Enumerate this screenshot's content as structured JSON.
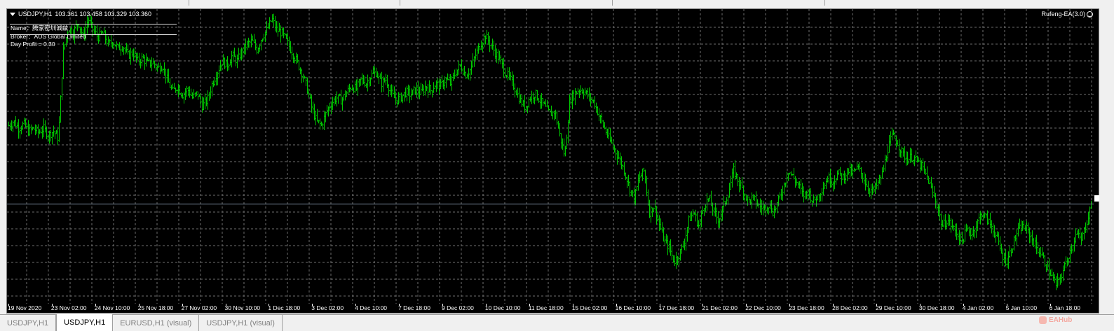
{
  "chart_header": {
    "symbol_label": "USDJPY,H1",
    "ohlc_label": "103.361 103.458 103.329 103.360"
  },
  "expert": {
    "name_label": "Rufeng-EA(3.0)",
    "status_icon": "smiley-icon"
  },
  "info_panel": {
    "name": "Name：腾家密圳诚兹",
    "broker": "Broker：AUS Global Limited",
    "profit": "Day Profit = 0.30"
  },
  "time_axis": [
    "19 Nov 2020",
    "23 Nov 02:00",
    "24 Nov 10:00",
    "25 Nov 18:00",
    "27 Nov 02:00",
    "30 Nov 10:00",
    "1 Dec 18:00",
    "3 Dec 02:00",
    "4 Dec 10:00",
    "7 Dec 18:00",
    "9 Dec 02:00",
    "10 Dec 10:00",
    "11 Dec 18:00",
    "15 Dec 02:00",
    "16 Dec 10:00",
    "17 Dec 18:00",
    "21 Dec 02:00",
    "22 Dec 10:00",
    "23 Dec 18:00",
    "28 Dec 02:00",
    "29 Dec 10:00",
    "30 Dec 18:00",
    "4 Jan 02:00",
    "5 Jan 10:00",
    "6 Jan 18:00"
  ],
  "tabs": [
    {
      "label": "USDJPY,H1",
      "active": false
    },
    {
      "label": "USDJPY,H1",
      "active": true
    },
    {
      "label": "EURUSD,H1 (visual)",
      "active": false
    },
    {
      "label": "USDJPY,H1 (visual)",
      "active": false
    }
  ],
  "watermark": "EAHub",
  "colors": {
    "background": "#000000",
    "grid": "#6e6e6e",
    "bars": "#00c800",
    "bid_line": "#778899"
  },
  "chart_data": {
    "type": "ohlc",
    "symbol": "USDJPY",
    "timeframe": "H1",
    "last": 103.36,
    "ylim": [
      102.65,
      104.75
    ],
    "grid": true,
    "close_path": [
      103.92,
      103.95,
      103.9,
      103.93,
      103.88,
      103.9,
      103.87,
      103.9,
      103.85,
      103.88,
      103.83,
      104.45,
      104.62,
      104.58,
      104.66,
      104.55,
      104.68,
      104.6,
      104.55,
      104.58,
      104.5,
      104.52,
      104.47,
      104.49,
      104.42,
      104.44,
      104.38,
      104.4,
      104.36,
      104.37,
      104.33,
      104.35,
      104.24,
      104.16,
      104.2,
      104.14,
      104.18,
      104.12,
      104.15,
      104.06,
      104.1,
      104.22,
      104.3,
      104.38,
      104.35,
      104.42,
      104.38,
      104.45,
      104.5,
      104.52,
      104.46,
      104.55,
      104.6,
      104.68,
      104.6,
      104.58,
      104.52,
      104.45,
      104.38,
      104.3,
      104.2,
      104.05,
      103.95,
      103.92,
      104.02,
      104.08,
      104.12,
      104.1,
      104.15,
      104.2,
      104.18,
      104.25,
      104.22,
      104.28,
      104.3,
      104.22,
      104.25,
      104.15,
      104.1,
      104.12,
      104.16,
      104.14,
      104.18,
      104.15,
      104.2,
      104.17,
      104.22,
      104.2,
      104.25,
      104.22,
      104.3,
      104.35,
      104.28,
      104.32,
      104.42,
      104.5,
      104.56,
      104.5,
      104.44,
      104.38,
      104.3,
      104.25,
      104.18,
      104.1,
      104.05,
      104.12,
      104.15,
      104.1,
      104.05,
      104.0,
      104.02,
      103.85,
      103.7,
      104.1,
      104.15,
      104.18,
      104.16,
      104.12,
      104.08,
      103.98,
      103.9,
      103.82,
      103.75,
      103.68,
      103.6,
      103.48,
      103.4,
      103.55,
      103.6,
      103.3,
      103.35,
      103.22,
      103.1,
      103.05,
      102.95,
      103.0,
      103.08,
      103.25,
      103.3,
      103.2,
      103.35,
      103.4,
      103.3,
      103.25,
      103.35,
      103.45,
      103.6,
      103.52,
      103.45,
      103.38,
      103.4,
      103.35,
      103.33,
      103.36,
      103.3,
      103.38,
      103.48,
      103.6,
      103.55,
      103.5,
      103.42,
      103.45,
      103.38,
      103.42,
      103.48,
      103.55,
      103.52,
      103.58,
      103.55,
      103.6,
      103.58,
      103.62,
      103.56,
      103.48,
      103.45,
      103.5,
      103.58,
      103.75,
      103.85,
      103.8,
      103.72,
      103.68,
      103.7,
      103.66,
      103.62,
      103.55,
      103.45,
      103.35,
      103.2,
      103.25,
      103.2,
      103.15,
      103.1,
      103.18,
      103.15,
      103.22,
      103.3,
      103.25,
      103.2,
      103.12,
      103.0,
      102.95,
      103.05,
      103.15,
      103.2,
      103.18,
      103.12,
      103.05,
      103.0,
      102.92,
      102.85,
      102.78,
      102.85,
      102.95,
      103.05,
      103.15,
      103.1,
      103.22,
      103.36
    ]
  }
}
